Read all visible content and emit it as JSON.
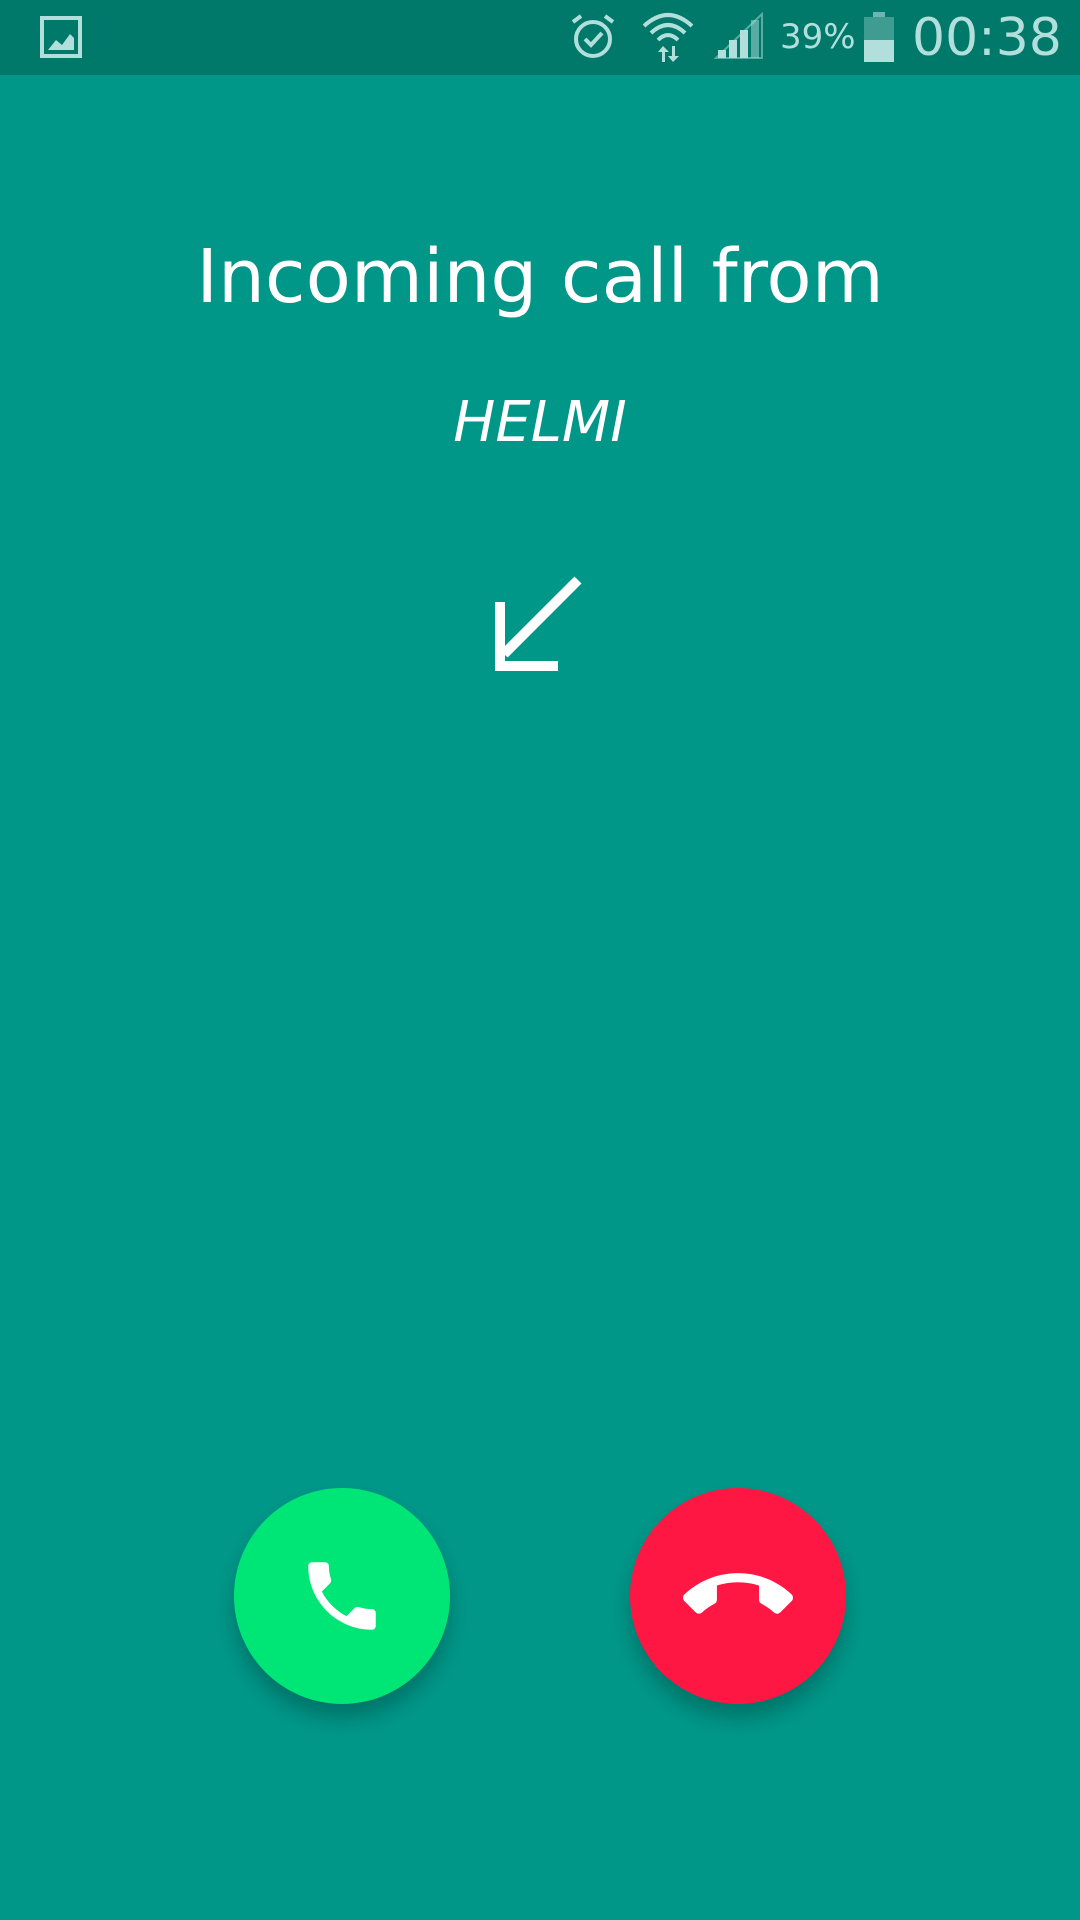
{
  "status_bar": {
    "battery_percent": "39%",
    "time": "00:38"
  },
  "call": {
    "title": "Incoming call from",
    "caller_name": "HELMI"
  },
  "actions": {
    "accept_icon": "phone-icon",
    "decline_icon": "hang-up-icon"
  },
  "colors": {
    "background": "#009688",
    "status_bar": "#00796b",
    "accept": "#00e676",
    "decline": "#ff1744"
  }
}
